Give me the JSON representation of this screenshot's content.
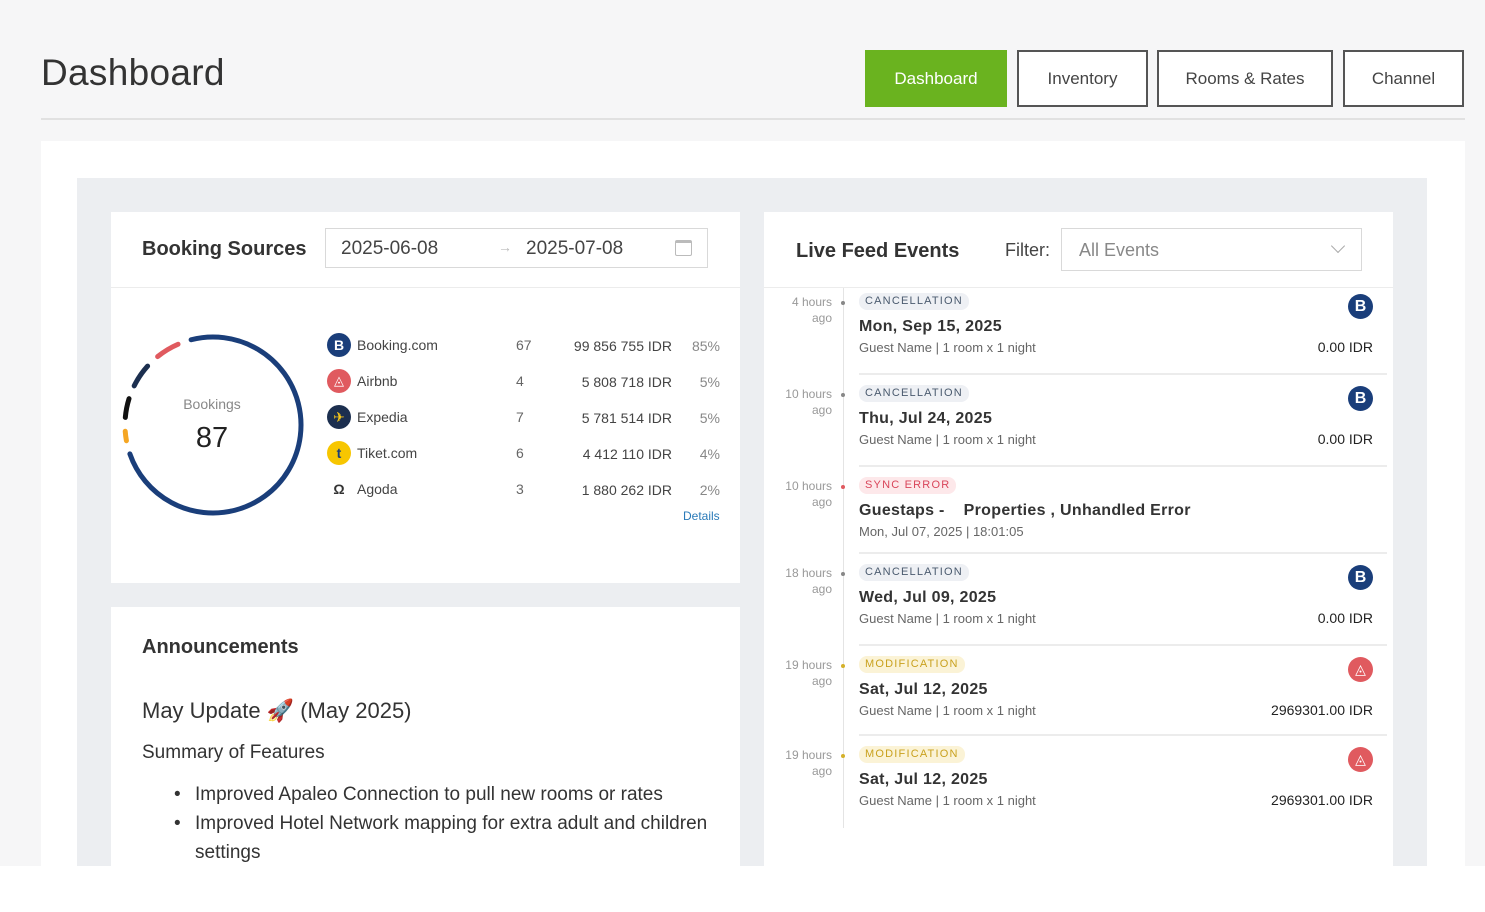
{
  "header": {
    "title": "Dashboard",
    "nav": [
      {
        "label": "Dashboard",
        "active": true
      },
      {
        "label": "Inventory",
        "active": false
      },
      {
        "label": "Rooms & Rates",
        "active": false
      },
      {
        "label": "Channel",
        "active": false
      }
    ]
  },
  "booking_sources": {
    "title": "Booking Sources",
    "date_from": "2025-06-08",
    "date_to": "2025-07-08",
    "ring_label": "Bookings",
    "ring_value": "87",
    "details_label": "Details",
    "rows": [
      {
        "name": "Booking.com",
        "count": "67",
        "amount": "99 856 755 IDR",
        "pct": "85%",
        "icon": "booking-icon",
        "color": "#1a3e7a",
        "fraction": 0.85
      },
      {
        "name": "Airbnb",
        "count": "4",
        "amount": "5 808 718 IDR",
        "pct": "5%",
        "icon": "airbnb-icon",
        "color": "#e05a5f",
        "fraction": 0.05
      },
      {
        "name": "Expedia",
        "count": "7",
        "amount": "5 781 514 IDR",
        "pct": "5%",
        "icon": "expedia-icon",
        "color": "#1c2f4f",
        "fraction": 0.05
      },
      {
        "name": "Tiket.com",
        "count": "6",
        "amount": "4 412 110 IDR",
        "pct": "4%",
        "icon": "tiket-icon",
        "color": "#111111",
        "fraction": 0.04
      },
      {
        "name": "Agoda",
        "count": "3",
        "amount": "1 880 262 IDR",
        "pct": "2%",
        "icon": "agoda-icon",
        "color": "#f5a623",
        "fraction": 0.02
      }
    ]
  },
  "announcements": {
    "title": "Announcements",
    "headline": "May Update 🚀 (May 2025)",
    "summary_title": "Summary of Features",
    "items": [
      "Improved Apaleo Connection to pull new rooms or rates",
      "Improved Hotel Network mapping for extra adult and children settings"
    ]
  },
  "live_feed": {
    "title": "Live Feed Events",
    "filter_label": "Filter:",
    "filter_value": "All Events",
    "events": [
      {
        "time_line1": "4 hours",
        "time_line2": "ago",
        "tag": "CANCELLATION",
        "tag_kind": "cancel",
        "title": "Mon, Sep 15, 2025",
        "subtitle": "Guest Name | 1 room x 1 night",
        "amount": "0.00 IDR",
        "icon": "booking-icon"
      },
      {
        "time_line1": "10 hours",
        "time_line2": "ago",
        "tag": "CANCELLATION",
        "tag_kind": "cancel",
        "title": "Thu, Jul 24, 2025",
        "subtitle": "Guest Name | 1 room x 1 night",
        "amount": "0.00 IDR",
        "icon": "booking-icon"
      },
      {
        "time_line1": "10 hours",
        "time_line2": "ago",
        "tag": "SYNC ERROR",
        "tag_kind": "error",
        "title": "Guestaps -    Properties , Unhandled Error",
        "subtitle": "Mon, Jul 07, 2025 | 18:01:05",
        "amount": "",
        "icon": ""
      },
      {
        "time_line1": "18 hours",
        "time_line2": "ago",
        "tag": "CANCELLATION",
        "tag_kind": "cancel",
        "title": "Wed, Jul 09, 2025",
        "subtitle": "Guest Name | 1 room x 1 night",
        "amount": "0.00 IDR",
        "icon": "booking-icon"
      },
      {
        "time_line1": "19 hours",
        "time_line2": "ago",
        "tag": "MODIFICATION",
        "tag_kind": "modify",
        "title": "Sat, Jul 12, 2025",
        "subtitle": "Guest Name | 1 room x 1 night",
        "amount": "2969301.00 IDR",
        "icon": "airbnb-icon"
      },
      {
        "time_line1": "19 hours",
        "time_line2": "ago",
        "tag": "MODIFICATION",
        "tag_kind": "modify",
        "title": "Sat, Jul 12, 2025",
        "subtitle": "Guest Name | 1 room x 1 night",
        "amount": "2969301.00 IDR",
        "icon": "airbnb-icon"
      }
    ]
  }
}
